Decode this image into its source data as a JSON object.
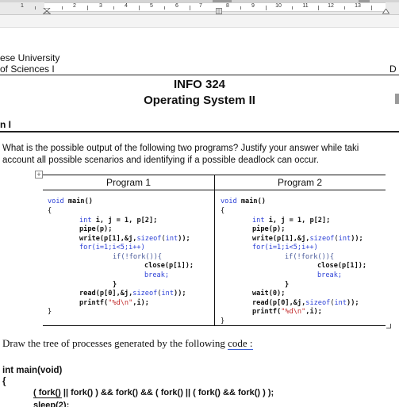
{
  "ruler": {
    "numbers": [
      "1",
      "2",
      "3",
      "4",
      "5",
      "6",
      "7",
      "8",
      "9",
      "10",
      "11",
      "12",
      "13"
    ]
  },
  "header": {
    "university": "ese University",
    "faculty": "of Sciences I",
    "right_label": "D",
    "course_code": "INFO 324",
    "course_name": "Operating System II"
  },
  "section": {
    "title": "n I"
  },
  "question1": {
    "line1": "What is the possible output of the following two programs? Justify your answer while taki",
    "line2": "account all possible scenarios and identifying if a possible deadlock can occur."
  },
  "table": {
    "handle_glyph": "+",
    "col1_header": "Program 1",
    "col2_header": "Program 2",
    "program1": {
      "l1a": "void",
      "l1b": " main()",
      "l2": "{",
      "l3a": "int",
      "l3b": " i, j = 1, p[2];",
      "l4": "pipe(p);",
      "l5a": "write(p[1],&j,",
      "l5b": "sizeof",
      "l5c": "(",
      "l5d": "int",
      "l5e": "));",
      "l6": "for(i=1;i<5;i++)",
      "l7": "if(!fork()){",
      "l8": "close(p[1]);",
      "l9": "break;",
      "l10": "}",
      "l11a": "read(p[0],&j,",
      "l11b": "sizeof",
      "l11c": "(",
      "l11d": "int",
      "l11e": "));",
      "l12a": "printf(",
      "l12b": "\"%d\\n\"",
      "l12c": ",i);",
      "l13": "}"
    },
    "program2": {
      "l1a": "void",
      "l1b": " main()",
      "l2": "{",
      "l3a": "int",
      "l3b": " i, j = 1, p[2];",
      "l4": "pipe(p);",
      "l5a": "write(p[1],&j,",
      "l5b": "sizeof",
      "l5c": "(",
      "l5d": "int",
      "l5e": "));",
      "l6": "for(i=1;i<5;i++)",
      "l7": "if(!fork()){",
      "l8": "close(p[1]);",
      "l9": "break;",
      "l10": "}",
      "l11": "wait(0);",
      "l12a": "read(p[0],&j,",
      "l12b": "sizeof",
      "l12c": "(",
      "l12d": "int",
      "l12e": "));",
      "l13a": "printf(",
      "l13b": "\"%d\\n\"",
      "l13c": ",i);",
      "l14": "}"
    }
  },
  "question2": {
    "text_before": "Draw the tree of processes generated by the following ",
    "text_link": "code :",
    "main_decl": "int main(void)",
    "open_brace": "{",
    "fork_expr": "( fork() || fork() ) && fork() && ( fork() || ( fork() && fork() ) );",
    "sleep_line": "sleep(2);"
  },
  "colors": {
    "keyword": "#2a3fd6",
    "string": "#c22c2c",
    "ruler_bg": "#e9e9e9"
  }
}
